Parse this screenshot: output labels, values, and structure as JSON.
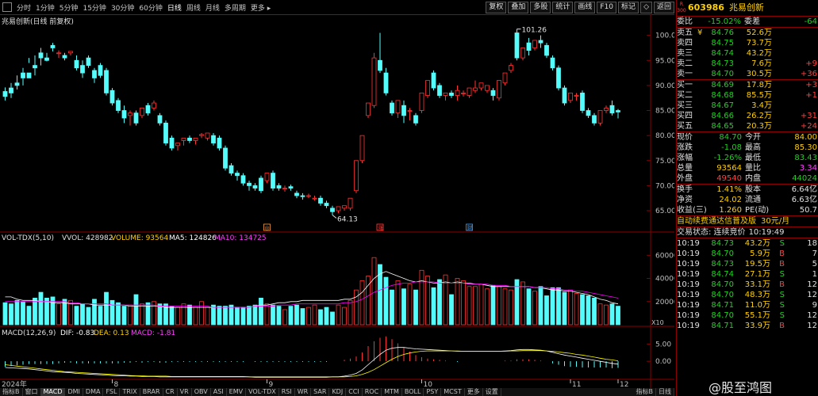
{
  "toolbar": {
    "periods": [
      "分时",
      "1分钟",
      "5分钟",
      "15分钟",
      "30分钟",
      "60分钟",
      "日线",
      "周线",
      "月线",
      "多周期",
      "更多 ▸"
    ],
    "active_period": "日线",
    "right_buttons": [
      "复权",
      "叠加",
      "多股",
      "统计",
      "画线",
      "F10",
      "标记",
      "◇",
      "返回"
    ]
  },
  "chart_title": "兆易创新(日线 前复权)",
  "price_axis": [
    "100.0",
    "95.00",
    "90.00",
    "85.00",
    "80.00",
    "75.00",
    "70.00",
    "65.00"
  ],
  "price_annotations": {
    "high": "101.26",
    "low": "64.13"
  },
  "event_markers": [
    "◎",
    "涨",
    "财"
  ],
  "vol_header": {
    "name": "VOL-TDX(5,10)",
    "vvol": "VVOL: 428982",
    "volume": "VOLUME: 93564",
    "ma5": "MA5: 124826",
    "ma10": "MA10: 134725"
  },
  "vol_axis": [
    "60000",
    "40000",
    "20000"
  ],
  "vol_unit": "X10",
  "macd_header": {
    "name": "MACD(12,26,9)",
    "dif": "DIF: -0.83",
    "dea": "DEA: 0.13",
    "macd": "MACD: -1.81"
  },
  "macd_axis": [
    "5.00",
    "0.00"
  ],
  "time_axis": [
    "2024年",
    "8",
    "9",
    "10",
    "11",
    "12"
  ],
  "period_label": "日线",
  "colors": {
    "up": "#ff3232",
    "down": "#54fcfc",
    "dif": "#ffffff",
    "dea": "#ffff00",
    "ma5": "#ffffff",
    "ma10": "#ff00ff"
  },
  "quote": {
    "code": "603986",
    "name": "兆易创新",
    "badge_top": "R",
    "badge_bottom": "300",
    "webi_label": "委比",
    "webi": "-15.02%",
    "weicha_label": "委差",
    "weicha": "-64",
    "asks": [
      {
        "label": "卖五",
        "flag": "¥",
        "price": "84.76",
        "vol": "52.6万",
        "chg": ""
      },
      {
        "label": "卖四",
        "flag": "",
        "price": "84.75",
        "vol": "73.7万",
        "chg": ""
      },
      {
        "label": "卖三",
        "flag": "",
        "price": "84.74",
        "vol": "43.2万",
        "chg": ""
      },
      {
        "label": "卖二",
        "flag": "",
        "price": "84.73",
        "vol": "7.6万",
        "chg": "+9"
      },
      {
        "label": "卖一",
        "flag": "",
        "price": "84.70",
        "vol": "30.5万",
        "chg": "+36"
      }
    ],
    "bids": [
      {
        "label": "买一",
        "flag": "",
        "price": "84.69",
        "vol": "17.8万",
        "chg": "+3"
      },
      {
        "label": "买二",
        "flag": "",
        "price": "84.68",
        "vol": "85.5万",
        "chg": "+1"
      },
      {
        "label": "买三",
        "flag": "",
        "price": "84.67",
        "vol": "3.4万",
        "chg": ""
      },
      {
        "label": "买四",
        "flag": "",
        "price": "84.66",
        "vol": "26.2万",
        "chg": "+31"
      },
      {
        "label": "买五",
        "flag": "",
        "price": "84.65",
        "vol": "20.3万",
        "chg": "+24"
      }
    ],
    "stats": [
      {
        "l1": "现价",
        "v1": "84.70",
        "l2": "今开",
        "v2": "84.00"
      },
      {
        "l1": "涨跌",
        "v1": "-1.08",
        "l2": "最高",
        "v2": "85.30"
      },
      {
        "l1": "涨幅",
        "v1": "-1.26%",
        "l2": "最低",
        "v2": "83.43"
      },
      {
        "l1": "总量",
        "v1": "93564",
        "l2": "量比",
        "v2": "3.34"
      },
      {
        "l1": "外盘",
        "v1": "49540",
        "l2": "内盘",
        "v2": "44024"
      }
    ],
    "stats2": [
      {
        "l1": "换手",
        "v1": "1.41%",
        "l2": "股本",
        "v2": "6.64亿"
      },
      {
        "l1": "净资",
        "v1": "24.02",
        "l2": "流通",
        "v2": "6.63亿"
      },
      {
        "l1": "收益(三)",
        "v1": "1.260",
        "l2": "PE(动)",
        "v2": "50.7"
      }
    ],
    "promo": "自动续费通达信普及版",
    "promo_price": "30元/月",
    "trade_status": "交易状态: 连续竞价",
    "trade_time": "10:19:49",
    "ticks": [
      {
        "t": "10:19",
        "p": "84.73",
        "v": "43.2万",
        "s": "S",
        "n": "18"
      },
      {
        "t": "10:19",
        "p": "84.70",
        "v": "5.9万",
        "s": "B",
        "n": "7"
      },
      {
        "t": "10:19",
        "p": "84.73",
        "v": "19.5万",
        "s": "B",
        "n": "5"
      },
      {
        "t": "10:19",
        "p": "84.74",
        "v": "27.1万",
        "s": "S",
        "n": "1"
      },
      {
        "t": "10:19",
        "p": "84.70",
        "v": "33.1万",
        "s": "B",
        "n": "12"
      },
      {
        "t": "10:19",
        "p": "84.70",
        "v": "48.3万",
        "s": "S",
        "n": "12"
      },
      {
        "t": "10:19",
        "p": "84.71",
        "v": "11.0万",
        "s": "S",
        "n": "9"
      },
      {
        "t": "10:19",
        "p": "84.70",
        "v": "55.1万",
        "s": "S",
        "n": "12"
      },
      {
        "t": "10:19",
        "p": "84.71",
        "v": "33.9万",
        "s": "B",
        "n": "12"
      }
    ]
  },
  "watermark": "@股至鸿图",
  "indicator_tabs": [
    "指标A",
    "窗口",
    "MACD",
    "DMI",
    "DMA",
    "FSL",
    "TRIX",
    "BRAR",
    "CR",
    "VR",
    "OBV",
    "ASI",
    "EMV",
    "VOL-TDX",
    "RSI",
    "WR",
    "SAR",
    "KDJ",
    "CCI",
    "ROC",
    "MTM",
    "BOLL",
    "PSY",
    "MCST",
    "更多",
    "设置"
  ],
  "active_tab": "MACD",
  "bottom_buttons": [
    "指标B",
    "日线"
  ],
  "chart_data": {
    "type": "candlestick",
    "ylim": [
      62,
      102
    ],
    "candles": [
      [
        88.8,
        89.6,
        87.8,
        87.0
      ],
      [
        89.5,
        90.5,
        88.5,
        87.5
      ],
      [
        90.5,
        92.0,
        90.0,
        89.2
      ],
      [
        92.5,
        93.5,
        91.5,
        90.0
      ],
      [
        92.5,
        95.5,
        91.5,
        94.5
      ],
      [
        94.0,
        96.0,
        93.5,
        92.0
      ],
      [
        96.5,
        97.5,
        95.5,
        94.0
      ],
      [
        95.5,
        96.5,
        95.0,
        94.8
      ],
      [
        98.0,
        98.5,
        97.5,
        96.8
      ],
      [
        96.5,
        97.0,
        96.5,
        95.5
      ],
      [
        96.0,
        96.5,
        95.5,
        95.0
      ],
      [
        96.5,
        96.8,
        96.8,
        96.0
      ],
      [
        95.0,
        96.0,
        93.5,
        93.0
      ],
      [
        94.0,
        95.0,
        92.5,
        91.5
      ],
      [
        95.5,
        96.0,
        94.0,
        93.5
      ],
      [
        93.0,
        93.5,
        91.5,
        90.5
      ],
      [
        94.0,
        94.5,
        92.0,
        91.5
      ],
      [
        93.0,
        93.5,
        88.5,
        88.0
      ],
      [
        89.0,
        89.5,
        86.5,
        86.0
      ],
      [
        87.0,
        87.5,
        85.0,
        84.5
      ],
      [
        85.0,
        86.0,
        83.5,
        82.5
      ],
      [
        84.0,
        85.0,
        84.5,
        82.0
      ],
      [
        84.5,
        85.0,
        82.5,
        82.0
      ],
      [
        84.0,
        84.5,
        85.5,
        83.5
      ],
      [
        86.0,
        86.5,
        84.5,
        84.0
      ],
      [
        85.5,
        87.0,
        86.5,
        85.0
      ],
      [
        84.0,
        84.5,
        82.5,
        82.0
      ],
      [
        82.5,
        83.0,
        78.5,
        78.0
      ],
      [
        79.5,
        80.0,
        77.5,
        77.0
      ],
      [
        78.0,
        78.5,
        78.5,
        77.0
      ],
      [
        79.0,
        79.5,
        79.5,
        78.0
      ],
      [
        79.5,
        80.0,
        79.0,
        78.5
      ],
      [
        79.0,
        79.5,
        79.5,
        78.2
      ],
      [
        80.0,
        80.5,
        80.2,
        79.5
      ],
      [
        79.5,
        80.5,
        80.5,
        79.0
      ],
      [
        80.0,
        80.5,
        78.5,
        78.0
      ],
      [
        79.5,
        80.0,
        77.5,
        77.0
      ],
      [
        77.5,
        78.0,
        73.5,
        73.0
      ],
      [
        74.0,
        74.5,
        72.5,
        72.0
      ],
      [
        72.5,
        73.0,
        72.0,
        71.0
      ],
      [
        72.0,
        72.5,
        70.5,
        70.0
      ],
      [
        70.5,
        71.0,
        70.0,
        69.0
      ],
      [
        70.0,
        70.5,
        69.5,
        69.0
      ],
      [
        71.5,
        72.0,
        69.0,
        68.5
      ],
      [
        71.0,
        71.5,
        72.5,
        70.5
      ],
      [
        72.5,
        73.0,
        69.5,
        69.0
      ],
      [
        70.0,
        70.5,
        69.5,
        69.0
      ],
      [
        69.5,
        70.0,
        69.5,
        68.8
      ],
      [
        69.8,
        70.2,
        69.5,
        69.0
      ],
      [
        68.5,
        69.0,
        68.0,
        67.5
      ],
      [
        68.0,
        68.5,
        67.8,
        67.2
      ],
      [
        68.0,
        68.4,
        68.0,
        67.5
      ],
      [
        67.5,
        68.0,
        67.5,
        67.0
      ],
      [
        67.5,
        68.0,
        66.5,
        66.0
      ],
      [
        66.5,
        67.0,
        66.0,
        65.5
      ],
      [
        65.5,
        66.0,
        64.8,
        64.13
      ],
      [
        65.0,
        65.5,
        65.8,
        64.5
      ],
      [
        65.5,
        66.0,
        66.0,
        65.0
      ],
      [
        65.5,
        66.5,
        67.5,
        65.0
      ],
      [
        69.0,
        70.0,
        75.0,
        68.5
      ],
      [
        75.0,
        77.0,
        80.0,
        74.5
      ],
      [
        84.0,
        86.0,
        86.5,
        83.5
      ],
      [
        86.0,
        96.5,
        95.5,
        85.5
      ],
      [
        95.0,
        100.5,
        93.0,
        92.5
      ],
      [
        92.5,
        93.5,
        88.5,
        88.0
      ],
      [
        86.5,
        87.0,
        84.5,
        84.0
      ],
      [
        84.5,
        85.5,
        87.0,
        83.5
      ],
      [
        86.0,
        87.0,
        84.0,
        82.5
      ],
      [
        85.0,
        85.5,
        85.0,
        83.0
      ],
      [
        84.0,
        84.5,
        82.5,
        82.0
      ],
      [
        85.0,
        86.5,
        88.5,
        84.5
      ],
      [
        88.0,
        88.5,
        91.0,
        87.5
      ],
      [
        92.5,
        93.0,
        89.5,
        89.0
      ],
      [
        90.0,
        90.5,
        88.0,
        87.5
      ],
      [
        88.0,
        88.5,
        88.5,
        87.0
      ],
      [
        88.5,
        89.0,
        88.0,
        87.5
      ],
      [
        88.0,
        90.0,
        89.0,
        87.0
      ],
      [
        88.5,
        89.0,
        88.5,
        87.8
      ],
      [
        88.0,
        88.5,
        89.5,
        87.5
      ],
      [
        89.0,
        91.0,
        89.5,
        88.5
      ],
      [
        89.5,
        90.5,
        90.5,
        89.0
      ],
      [
        89.0,
        90.0,
        90.0,
        88.5
      ],
      [
        89.0,
        89.5,
        88.0,
        87.0
      ],
      [
        87.5,
        88.0,
        91.0,
        87.0
      ],
      [
        90.5,
        91.0,
        92.5,
        90.0
      ],
      [
        93.0,
        94.5,
        94.0,
        92.5
      ],
      [
        100.5,
        101.26,
        95.5,
        95.0
      ],
      [
        95.5,
        96.0,
        97.5,
        95.0
      ],
      [
        98.5,
        99.5,
        97.0,
        96.0
      ],
      [
        97.5,
        98.0,
        99.0,
        97.0
      ],
      [
        99.0,
        100.0,
        98.5,
        97.5
      ],
      [
        98.0,
        98.5,
        96.0,
        95.5
      ],
      [
        95.5,
        96.0,
        93.5,
        93.0
      ],
      [
        93.5,
        94.0,
        89.5,
        89.0
      ],
      [
        89.5,
        90.0,
        86.5,
        86.0
      ],
      [
        87.0,
        87.5,
        88.5,
        86.5
      ],
      [
        88.0,
        88.5,
        88.0,
        87.0
      ],
      [
        88.5,
        89.0,
        85.0,
        84.5
      ],
      [
        85.0,
        85.5,
        84.0,
        83.5
      ],
      [
        84.0,
        84.5,
        82.5,
        82.0
      ],
      [
        82.5,
        83.0,
        85.0,
        82.0
      ],
      [
        85.0,
        86.0,
        85.5,
        84.5
      ],
      [
        86.0,
        87.0,
        84.5,
        84.0
      ],
      [
        85.0,
        85.3,
        84.7,
        83.43
      ]
    ],
    "volumes": [
      19,
      18,
      21,
      20,
      16,
      23,
      28,
      23,
      24,
      18,
      22,
      21,
      16,
      18,
      15,
      22,
      16,
      28,
      21,
      19,
      16,
      17,
      26,
      18,
      19,
      20,
      18,
      18,
      16,
      15,
      18,
      17,
      15,
      20,
      15,
      17,
      16,
      16,
      17,
      15,
      15,
      16,
      17,
      23,
      18,
      17,
      16,
      13,
      16,
      17,
      14,
      15,
      17,
      13,
      15,
      11,
      17,
      15,
      21,
      30,
      38,
      42,
      58,
      52,
      41,
      30,
      38,
      31,
      35,
      30,
      47,
      42,
      32,
      39,
      43,
      26,
      40,
      38,
      33,
      33,
      35,
      31,
      34,
      33,
      31,
      30,
      39,
      37,
      31,
      29,
      33,
      25,
      32,
      32,
      28,
      30,
      27,
      26,
      25,
      23,
      18,
      17,
      18,
      16
    ],
    "ma5": [
      24,
      24,
      22,
      21,
      21,
      21,
      20,
      20,
      19,
      19,
      19,
      18,
      18,
      18,
      18,
      17,
      17,
      17,
      17,
      17,
      17,
      16,
      16,
      16,
      16,
      16,
      16,
      15,
      15,
      15,
      15,
      15,
      15,
      15,
      15,
      15,
      15,
      15,
      15,
      15,
      15,
      15,
      16,
      17,
      17,
      18,
      19,
      19,
      20,
      20,
      21,
      21,
      21,
      21,
      21,
      21,
      21,
      22,
      22,
      24,
      28,
      34,
      40,
      44,
      46,
      44,
      42,
      40,
      38,
      37,
      38,
      37,
      36,
      36,
      37,
      36,
      37,
      36,
      36,
      35,
      35,
      34,
      33,
      33,
      33,
      33,
      33,
      33,
      33,
      32,
      32,
      31,
      30,
      30,
      29,
      29,
      28,
      27,
      26,
      24,
      22,
      21,
      19,
      18
    ],
    "ma10": [
      20,
      20,
      20,
      20,
      20,
      20,
      20,
      20,
      20,
      20,
      20,
      19,
      19,
      18,
      18,
      18,
      18,
      18,
      17,
      17,
      17,
      17,
      17,
      17,
      17,
      17,
      16,
      16,
      16,
      16,
      16,
      16,
      16,
      16,
      16,
      15,
      15,
      15,
      15,
      15,
      15,
      15,
      16,
      16,
      16,
      16,
      17,
      17,
      17,
      18,
      18,
      18,
      18,
      18,
      18,
      18,
      18,
      19,
      19,
      20,
      22,
      25,
      28,
      30,
      32,
      34,
      35,
      36,
      36,
      37,
      37,
      37,
      37,
      36,
      36,
      36,
      36,
      36,
      35,
      35,
      35,
      35,
      34,
      34,
      34,
      33,
      33,
      33,
      33,
      32,
      32,
      32,
      31,
      31,
      30,
      30,
      29,
      29,
      28,
      27,
      26,
      25,
      24,
      23
    ],
    "dif": [
      -1.8,
      -1.9,
      -2.0,
      -2.1,
      -2.2,
      -2.4,
      -2.6,
      -2.8,
      -3.0,
      -3.1,
      -3.2,
      -3.3,
      -3.5,
      -3.6,
      -3.7,
      -3.8,
      -3.9,
      -4.0,
      -4.1,
      -4.2,
      -4.2,
      -4.3,
      -4.3,
      -4.4,
      -4.4,
      -4.4,
      -4.5,
      -4.5,
      -4.5,
      -4.5,
      -4.5,
      -4.5,
      -4.5,
      -4.5,
      -4.5,
      -4.5,
      -4.5,
      -4.5,
      -4.5,
      -4.5,
      -4.5,
      -4.5,
      -4.6,
      -4.6,
      -4.6,
      -4.6,
      -4.6,
      -4.6,
      -4.6,
      -4.6,
      -4.6,
      -4.6,
      -4.6,
      -4.6,
      -4.6,
      -4.5,
      -4.5,
      -4.3,
      -4.0,
      -3.5,
      -2.5,
      -1.0,
      0.5,
      2.0,
      3.2,
      3.8,
      4.0,
      4.0,
      3.8,
      3.6,
      3.5,
      3.4,
      3.3,
      3.2,
      3.1,
      3.0,
      2.9,
      2.9,
      2.9,
      2.9,
      2.9,
      2.9,
      2.9,
      2.9,
      3.0,
      3.1,
      3.3,
      3.4,
      3.4,
      3.3,
      3.2,
      3.0,
      2.6,
      2.2,
      1.8,
      1.5,
      1.2,
      0.9,
      0.6,
      0.3,
      0.0,
      -0.3,
      -0.6,
      -0.83
    ],
    "dea": [
      -1.0,
      -1.2,
      -1.4,
      -1.6,
      -1.8,
      -2.0,
      -2.2,
      -2.4,
      -2.6,
      -2.8,
      -3.0,
      -3.1,
      -3.2,
      -3.3,
      -3.4,
      -3.5,
      -3.6,
      -3.7,
      -3.8,
      -3.9,
      -4.0,
      -4.1,
      -4.2,
      -4.2,
      -4.3,
      -4.3,
      -4.3,
      -4.3,
      -4.4,
      -4.4,
      -4.4,
      -4.4,
      -4.4,
      -4.4,
      -4.4,
      -4.4,
      -4.4,
      -4.4,
      -4.4,
      -4.4,
      -4.4,
      -4.5,
      -4.5,
      -4.5,
      -4.5,
      -4.5,
      -4.5,
      -4.5,
      -4.5,
      -4.5,
      -4.5,
      -4.5,
      -4.5,
      -4.5,
      -4.5,
      -4.5,
      -4.5,
      -4.5,
      -4.4,
      -4.2,
      -3.8,
      -3.2,
      -2.4,
      -1.4,
      -0.4,
      0.6,
      1.4,
      2.0,
      2.4,
      2.7,
      2.9,
      3.0,
      3.0,
      3.0,
      3.0,
      3.0,
      3.0,
      2.9,
      2.9,
      2.9,
      2.9,
      2.9,
      2.9,
      2.9,
      2.9,
      3.0,
      3.0,
      3.1,
      3.1,
      3.1,
      3.1,
      3.0,
      2.9,
      2.7,
      2.5,
      2.3,
      2.0,
      1.8,
      1.5,
      1.2,
      0.9,
      0.6,
      0.4,
      0.13
    ]
  }
}
